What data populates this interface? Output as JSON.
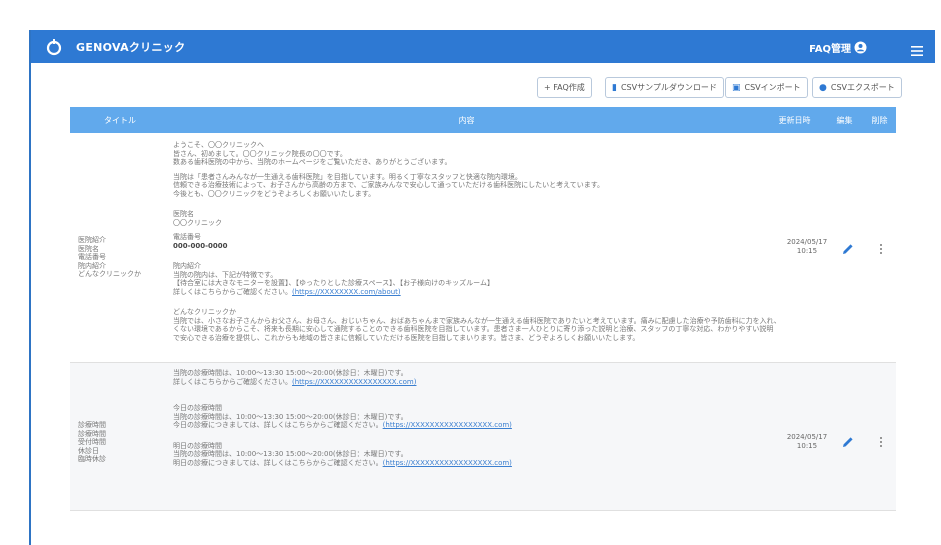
{
  "header": {
    "app_title": "GENOVAクリニック",
    "faq_manage": "FAQ管理"
  },
  "toolbar": {
    "add_faq": "+ FAQ作成",
    "csv_sample_download": "CSVサンプルダウンロード",
    "csv_import": "CSVインポート",
    "csv_export": "CSVエクスポート"
  },
  "table": {
    "columns": {
      "title": "タイトル",
      "content": "内容",
      "updated": "更新日時",
      "edit": "編集",
      "delete": "削除"
    },
    "rows": [
      {
        "title_lines": [
          "医院紹介",
          "医院名",
          "電話番号",
          "院内紹介",
          "どんなクリニックか"
        ],
        "date": "2024/05/17",
        "time": "10:15",
        "content": {
          "intro": [
            "ようこそ、〇〇クリニックへ",
            "皆さん、初めまして。〇〇クリニック院長の〇〇です。",
            "数ある歯科医院の中から、当院のホームページをご覧いただき、ありがとうございます。"
          ],
          "policy": [
            "当院は「患者さんみんなが一生通える歯科医院」を目指しています。明るく丁寧なスタッフと快適な院内環境。",
            "信頼できる治療技術によって、お子さんから高齢の方まで、ご家族みんなで安心して通っていただける歯科医院にしたいと考えています。",
            "今後とも、〇〇クリニックをどうぞよろしくお願いいたします。"
          ],
          "clinic_name_label": "医院名",
          "clinic_name": "〇〇クリニック",
          "phone_label": "電話番号",
          "phone": "000-000-0000",
          "facility_label": "院内紹介",
          "facility": [
            "当院の院内は、下記が特徴です。",
            "【待合室には大きなモニターを設置】、【ゆったりとした診療スペース】、【お子様向けのキッズルーム】",
            "詳しくはこちらからご確認ください。"
          ],
          "facility_link": "(https://XXXXXXXX.com/about)",
          "what_label": "どんなクリニックか",
          "what": [
            "当院では、小さなお子さんからお父さん、お母さん、おじいちゃん、おばあちゃんまで家族みんなが一生通える歯科医院でありたいと考えています。痛みに配慮した治療や予防歯科に力を入れ、",
            "くない環境であるからこそ、将来も長期に安心して通院することのできる歯科医院を目指しています。患者さま一人ひとりに寄り添った説明と治療、スタッフの丁寧な対応、わかりやすい説明",
            "で安心できる治療を提供し、これからも地域の皆さまに信頼していただける医院を目指してまいります。皆さま、どうぞよろしくお願いいたします。"
          ]
        }
      },
      {
        "title_lines": [
          "診療時間",
          "診療時間",
          "受付時間",
          "休診日",
          "臨時休診"
        ],
        "date": "2024/05/17",
        "time": "10:15",
        "content": {
          "hours": [
            "当院の診療時間は、10:00～13:30 15:00～20:00(休診日：木曜日)です。",
            "詳しくはこちらからご確認ください。"
          ],
          "hours_link": "(https://XXXXXXXXXXXXXXXX.com)",
          "today_label": "今日の診療時間",
          "today": [
            "当院の診療時間は、10:00～13:30 15:00～20:00(休診日：木曜日)です。",
            "今日の診療につきましては、詳しくはこちらからご確認ください。"
          ],
          "today_link": "(https://XXXXXXXXXXXXXXXXX.com)",
          "tomorrow_label": "明日の診療時間",
          "tomorrow": [
            "当院の診療時間は、10:00～13:30 15:00～20:00(休診日：木曜日)です。",
            "明日の診療につきましては、詳しくはこちらからご確認ください。"
          ],
          "tomorrow_link": "(https://XXXXXXXXXXXXXXXXX.com)"
        }
      }
    ]
  },
  "colors": {
    "appbar": "#2e79d3",
    "table_header": "#61a9ec",
    "link": "#3b7fd0"
  }
}
